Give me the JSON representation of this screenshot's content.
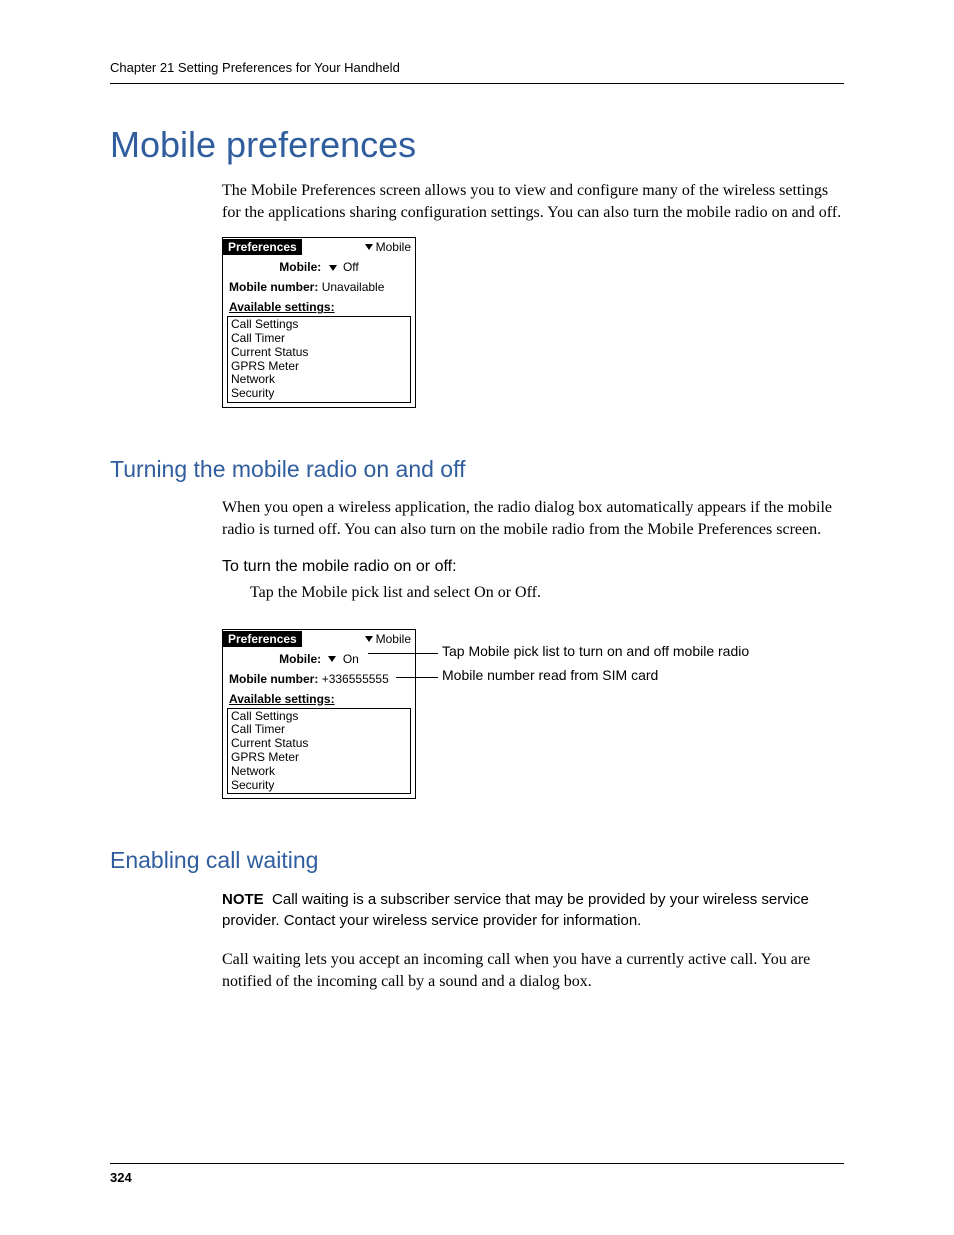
{
  "runningHead": "Chapter 21    Setting Preferences for Your Handheld",
  "pageNumber": "324",
  "h1": "Mobile preferences",
  "intro": "The Mobile Preferences screen allows you to view and configure many of the wireless settings for the applications sharing configuration settings. You can also turn the mobile radio on and off.",
  "palm1": {
    "title": "Preferences",
    "menu": "Mobile",
    "mobileLabel": "Mobile:",
    "mobileValue": "Off",
    "mobNumLabel": "Mobile number:",
    "mobNumValue": "Unavailable",
    "availLabel": "Available settings:",
    "items": [
      "Call Settings",
      "Call Timer",
      "Current Status",
      "GPRS Meter",
      "Network",
      "Security"
    ]
  },
  "h2a": "Turning the mobile radio on and off",
  "para2": "When you open a wireless application, the radio dialog box automatically appears if the mobile radio is turned off. You can also turn on the mobile radio from the Mobile Preferences screen.",
  "procHead": "To turn the mobile radio on or off:",
  "step1": "Tap the Mobile pick list and select On or Off.",
  "palm2": {
    "title": "Preferences",
    "menu": "Mobile",
    "mobileLabel": "Mobile:",
    "mobileValue": "On",
    "mobNumLabel": "Mobile number:",
    "mobNumValue": "+336555555",
    "availLabel": "Available settings:",
    "items": [
      "Call Settings",
      "Call Timer",
      "Current Status",
      "GPRS Meter",
      "Network",
      "Security"
    ]
  },
  "callout1": "Tap Mobile pick list to turn on and off mobile radio",
  "callout2": "Mobile number read from SIM card",
  "h2b": "Enabling call waiting",
  "noteLabel": "NOTE",
  "noteBody": "Call waiting is a subscriber service that may be provided by your wireless service provider. Contact your wireless service provider for information.",
  "para3": "Call waiting lets you accept an incoming call when you have a currently active call. You are notified of the incoming call by a sound and a dialog box."
}
